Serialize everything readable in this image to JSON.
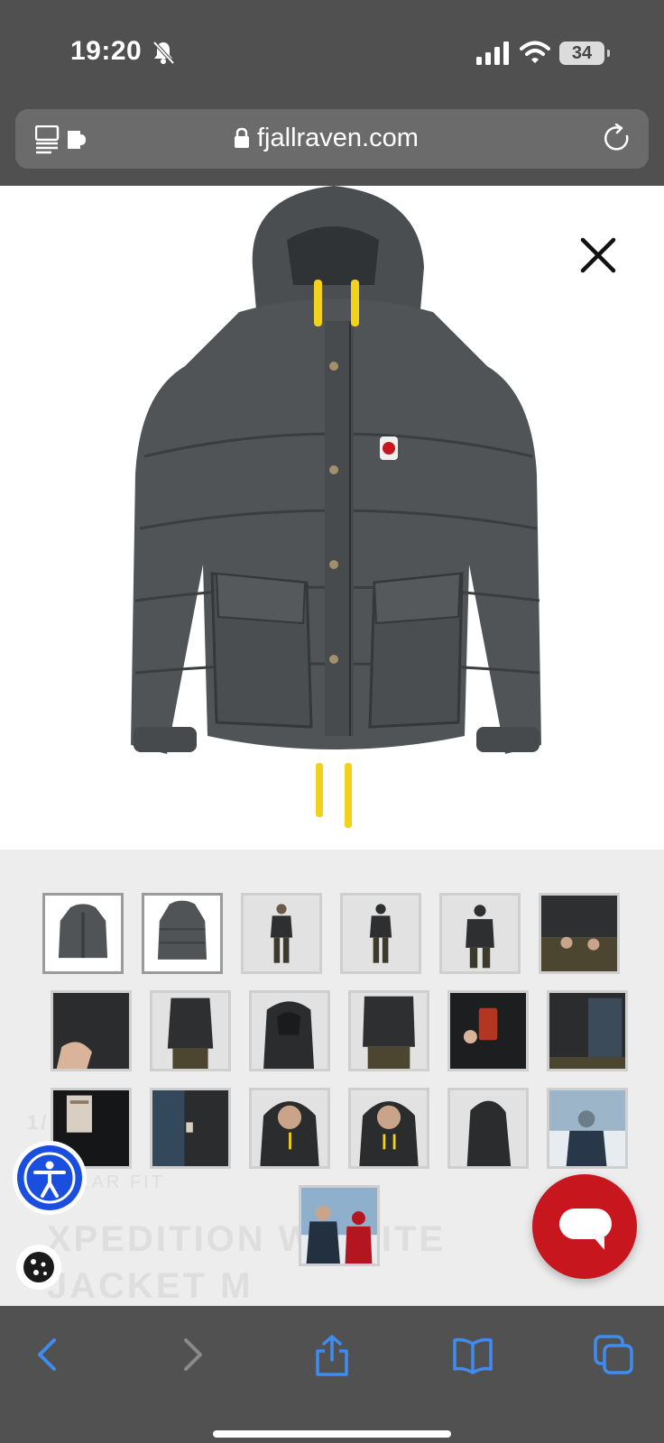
{
  "status_bar": {
    "time": "19:20",
    "battery": "34",
    "icons": [
      "bell-slash-icon",
      "signal-icon",
      "wifi-icon",
      "battery-icon"
    ]
  },
  "browser": {
    "url": "fjallraven.com",
    "icons": [
      "tabs-icon",
      "lock-icon",
      "reload-icon"
    ]
  },
  "product": {
    "image_alt": "jacket-photo",
    "background_ghost_fit": "ULAR FIT",
    "background_ghost_title": "XPEDITION    WN LITE",
    "background_ghost_line2": "JACKET M",
    "background_ghost_counter": "1/"
  },
  "gallery": {
    "thumbnail_count": 19,
    "selected_index": 0
  },
  "toolbar": {
    "icons": [
      "back-icon",
      "forward-icon",
      "share-icon",
      "bookmarks-icon",
      "tabs-overview-icon"
    ]
  },
  "colors": {
    "accent_blue": "#1a4ede",
    "chat_red": "#c8161e",
    "ios_blue": "#3f8cf0"
  }
}
